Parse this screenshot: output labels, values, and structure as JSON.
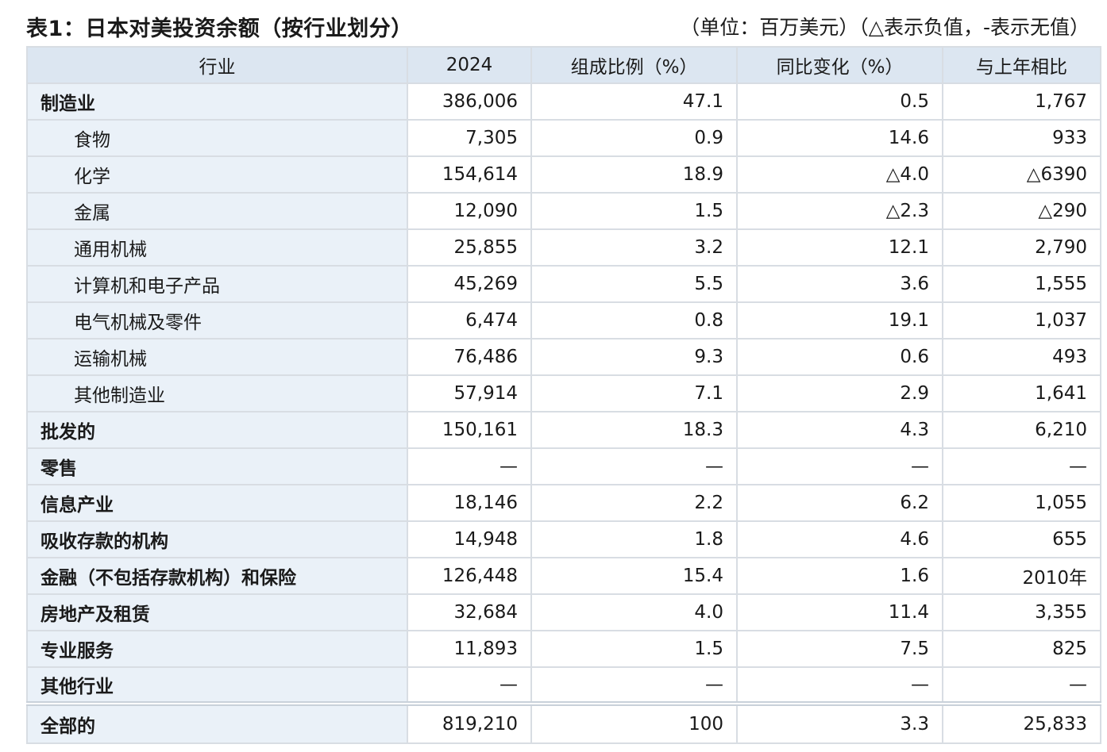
{
  "caption": {
    "title": "表1：日本对美投资余额（按行业划分）",
    "unit_note": "（单位：百万美元）（△表示负值，-表示无值）"
  },
  "table": {
    "headers": [
      "行业",
      "2024",
      "组成比例（%）",
      "同比变化（%）",
      "与上年相比"
    ],
    "rows": [
      {
        "name": "制造业",
        "level": 0,
        "values": [
          "386,006",
          "47.1",
          "0.5",
          "1,767"
        ]
      },
      {
        "name": "食物",
        "level": 1,
        "values": [
          "7,305",
          "0.9",
          "14.6",
          "933"
        ]
      },
      {
        "name": "化学",
        "level": 1,
        "values": [
          "154,614",
          "18.9",
          "△4.0",
          "△6390"
        ]
      },
      {
        "name": "金属",
        "level": 1,
        "values": [
          "12,090",
          "1.5",
          "△2.3",
          "△290"
        ]
      },
      {
        "name": "通用机械",
        "level": 1,
        "values": [
          "25,855",
          "3.2",
          "12.1",
          "2,790"
        ]
      },
      {
        "name": "计算机和电子产品",
        "level": 1,
        "values": [
          "45,269",
          "5.5",
          "3.6",
          "1,555"
        ]
      },
      {
        "name": "电气机械及零件",
        "level": 1,
        "values": [
          "6,474",
          "0.8",
          "19.1",
          "1,037"
        ]
      },
      {
        "name": "运输机械",
        "level": 1,
        "values": [
          "76,486",
          "9.3",
          "0.6",
          "493"
        ]
      },
      {
        "name": "其他制造业",
        "level": 1,
        "values": [
          "57,914",
          "7.1",
          "2.9",
          "1,641"
        ]
      },
      {
        "name": "批发的",
        "level": 0,
        "values": [
          "150,161",
          "18.3",
          "4.3",
          "6,210"
        ]
      },
      {
        "name": "零售",
        "level": 0,
        "values": [
          "—",
          "—",
          "—",
          "—"
        ]
      },
      {
        "name": "信息产业",
        "level": 0,
        "values": [
          "18,146",
          "2.2",
          "6.2",
          "1,055"
        ]
      },
      {
        "name": "吸收存款的机构",
        "level": 0,
        "values": [
          "14,948",
          "1.8",
          "4.6",
          "655"
        ]
      },
      {
        "name": "金融（不包括存款机构）和保险",
        "level": 0,
        "values": [
          "126,448",
          "15.4",
          "1.6",
          "2010年"
        ]
      },
      {
        "name": "房地产及租赁",
        "level": 0,
        "values": [
          "32,684",
          "4.0",
          "11.4",
          "3,355"
        ]
      },
      {
        "name": "专业服务",
        "level": 0,
        "values": [
          "11,893",
          "1.5",
          "7.5",
          "825"
        ]
      },
      {
        "name": "其他行业",
        "level": 0,
        "values": [
          "—",
          "—",
          "—",
          "—"
        ]
      }
    ],
    "total": {
      "name": "全部的",
      "values": [
        "819,210",
        "100",
        "3.3",
        "25,833"
      ]
    }
  }
}
